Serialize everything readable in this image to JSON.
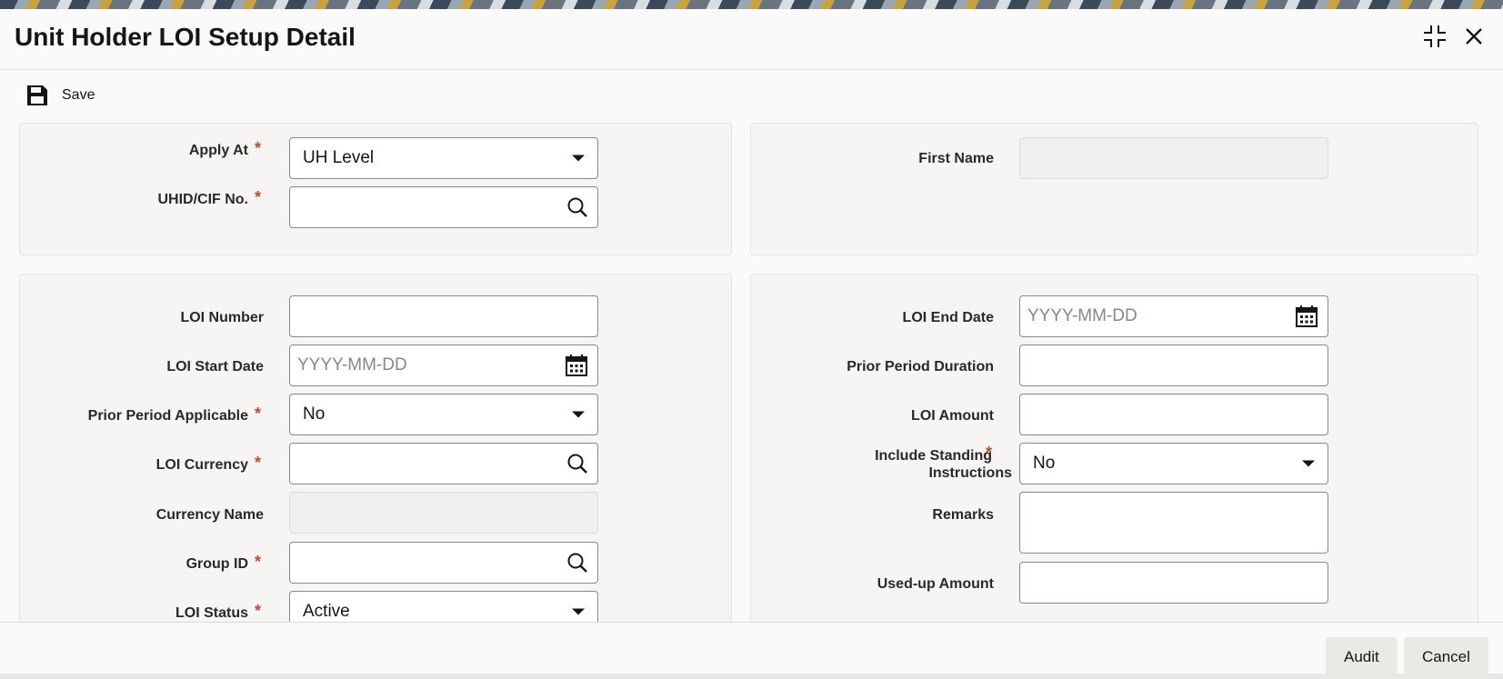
{
  "window": {
    "title": "Unit Holder LOI Setup Detail",
    "restore_icon": "restore-window-icon",
    "close_icon": "close-icon"
  },
  "toolbar": {
    "save_label": "Save",
    "save_icon": "floppy-disk-icon"
  },
  "colors": {
    "required": "#c74634",
    "panel_bg": "#f6f5f3",
    "input_border": "#8c8984"
  },
  "section1": {
    "apply_at": {
      "label": "Apply At",
      "value": "UH Level",
      "required": true
    },
    "uhid": {
      "label": "UHID/CIF No.",
      "value": "",
      "required": true
    },
    "first_name": {
      "label": "First Name",
      "value": ""
    }
  },
  "section2": {
    "loi_number": {
      "label": "LOI Number",
      "value": ""
    },
    "loi_start_date": {
      "label": "LOI Start Date",
      "placeholder": "YYYY-MM-DD"
    },
    "prior_period_applicable": {
      "label": "Prior Period Applicable",
      "value": "No",
      "required": true
    },
    "loi_currency": {
      "label": "LOI Currency",
      "value": "",
      "required": true
    },
    "currency_name": {
      "label": "Currency Name",
      "value": ""
    },
    "group_id": {
      "label": "Group ID",
      "value": "",
      "required": true
    },
    "loi_status": {
      "label": "LOI Status",
      "value": "Active",
      "required": true
    },
    "loi_end_date": {
      "label": "LOI End Date",
      "placeholder": "YYYY-MM-DD"
    },
    "prior_period_duration": {
      "label": "Prior Period Duration",
      "value": ""
    },
    "loi_amount": {
      "label": "LOI Amount",
      "value": ""
    },
    "include_standing_instructions": {
      "label_line1": "Include Standing",
      "label_line2": "Instructions",
      "value": "No",
      "required": true
    },
    "remarks": {
      "label": "Remarks",
      "value": ""
    },
    "used_up_amount": {
      "label": "Used-up Amount",
      "value": ""
    }
  },
  "footer": {
    "audit_label": "Audit",
    "cancel_label": "Cancel"
  },
  "required_marker": "*"
}
